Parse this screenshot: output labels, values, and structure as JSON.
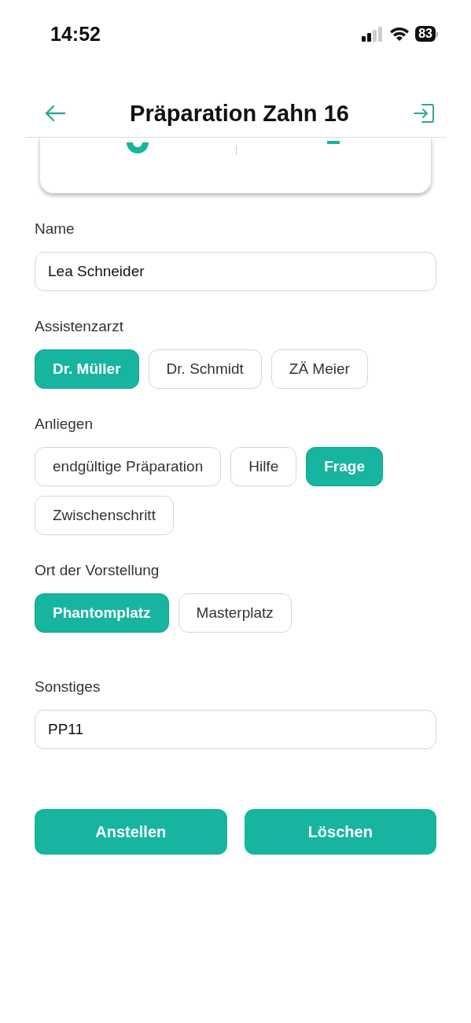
{
  "status_bar": {
    "time": "14:52",
    "battery": "83"
  },
  "header": {
    "title": "Präparation Zahn 16"
  },
  "fields": [
    {
      "label": "Name",
      "value": "Lea Schneider"
    }
  ],
  "groups": [
    {
      "label": "Assistenzarzt",
      "options": [
        {
          "label": "Dr. Müller",
          "selected": true
        },
        {
          "label": "Dr. Schmidt",
          "selected": false
        },
        {
          "label": "ZÄ Meier",
          "selected": false
        }
      ]
    },
    {
      "label": "Anliegen",
      "options": [
        {
          "label": "endgültige Präparation",
          "selected": false
        },
        {
          "label": "Hilfe",
          "selected": false
        },
        {
          "label": "Frage",
          "selected": true
        },
        {
          "label": "Zwischenschritt",
          "selected": false
        }
      ]
    },
    {
      "label": "Ort der Vorstellung",
      "options": [
        {
          "label": "Phantomplatz",
          "selected": true
        },
        {
          "label": "Masterplatz",
          "selected": false
        }
      ]
    }
  ],
  "other": {
    "label": "Sonstiges",
    "value": "PP11"
  },
  "buttons": [
    "Anstellen",
    "Löschen"
  ]
}
